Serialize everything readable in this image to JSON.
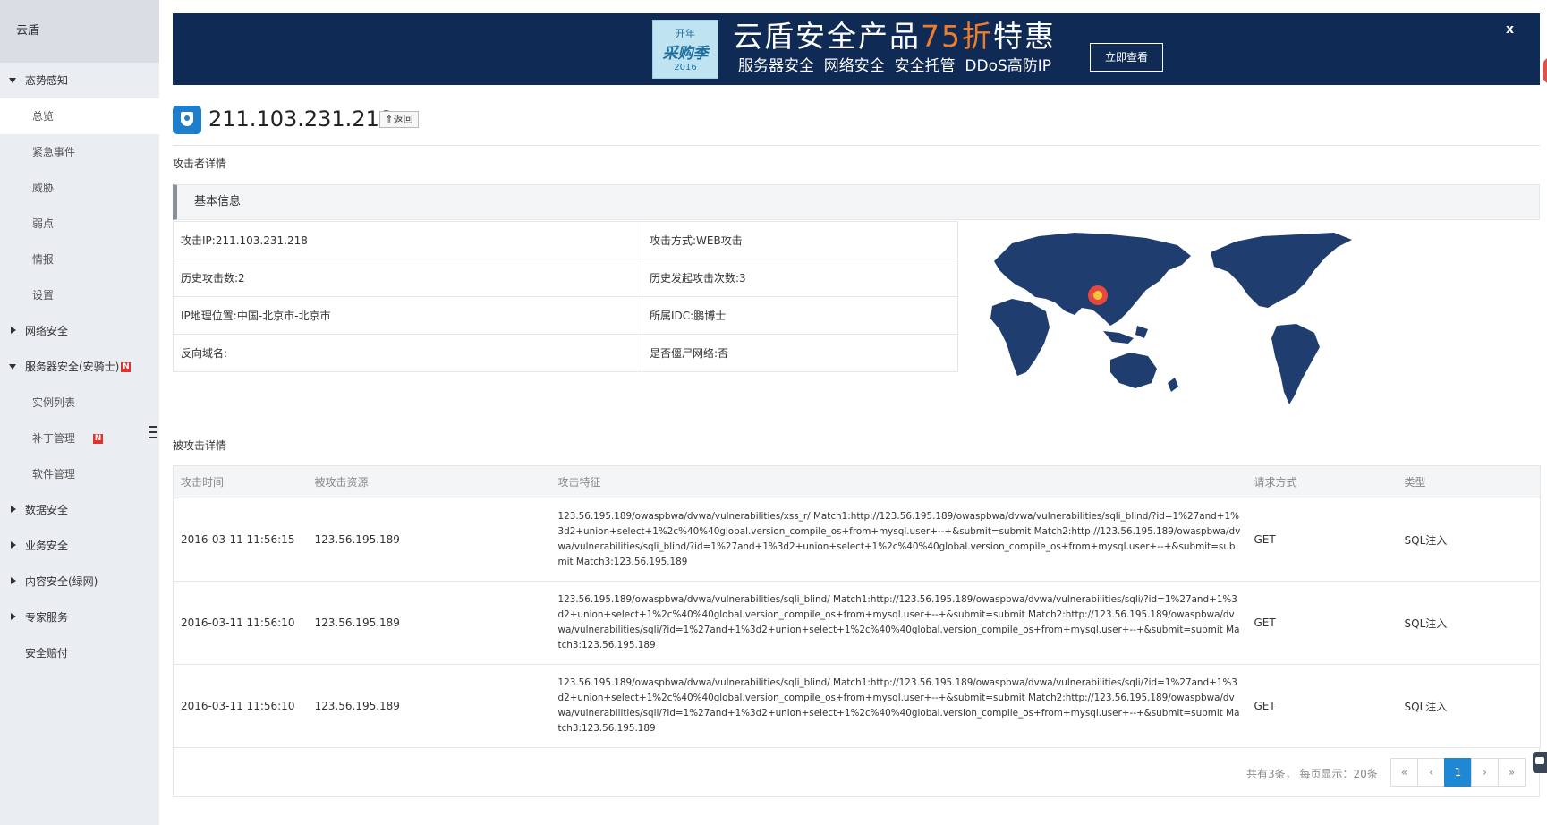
{
  "sidebar": {
    "title": "云盾",
    "items": [
      {
        "label": "态势感知",
        "caret": "down"
      },
      {
        "label": "总览"
      },
      {
        "label": "紧急事件"
      },
      {
        "label": "威胁"
      },
      {
        "label": "弱点"
      },
      {
        "label": "情报"
      },
      {
        "label": "设置"
      },
      {
        "label": "网络安全",
        "caret": "right"
      },
      {
        "label": "服务器安全(安骑士)",
        "caret": "down",
        "badge": "N"
      },
      {
        "label": "实例列表"
      },
      {
        "label": "补丁管理",
        "badge": "N"
      },
      {
        "label": "软件管理"
      },
      {
        "label": "数据安全",
        "caret": "right"
      },
      {
        "label": "业务安全",
        "caret": "right"
      },
      {
        "label": "内容安全(绿网)",
        "caret": "right"
      },
      {
        "label": "专家服务",
        "caret": "right"
      },
      {
        "label": "安全赔付"
      }
    ]
  },
  "banner": {
    "logo_line1": "开年",
    "logo_line2": "采购季",
    "logo_line3": "2016",
    "title_prefix": "云盾安全产品",
    "title_accent": "75折",
    "title_suffix": "特惠",
    "subtitle": "服务器安全  网络安全  安全托管  DDoS高防IP",
    "button_label": "立即查看",
    "close_label": "x"
  },
  "header": {
    "ip": "211.103.231.218",
    "back_label": "⇑返回"
  },
  "attacker_section_label": "攻击者详情",
  "basic_info": {
    "title": "基本信息",
    "rows": [
      [
        "攻击IP:211.103.231.218",
        "攻击方式:WEB攻击"
      ],
      [
        "历史攻击数:2",
        "历史发起攻击次数:3"
      ],
      [
        "IP地理位置:中国-北京市-北京市",
        "所属IDC:鹏博士"
      ],
      [
        "反向域名:",
        "是否僵尸网络:否"
      ]
    ]
  },
  "attacked_section_label": "被攻击详情",
  "attack_table": {
    "columns": [
      "攻击时间",
      "被攻击资源",
      "攻击特征",
      "请求方式",
      "类型"
    ],
    "rows": [
      [
        "2016-03-11 11:56:15",
        "123.56.195.189",
        "123.56.195.189/owaspbwa/dvwa/vulnerabilities/xss_r/ Match1:http://123.56.195.189/owaspbwa/dvwa/vulnerabilities/sqli_blind/?id=1%27and+1%3d2+union+select+1%2c%40%40global.version_compile_os+from+mysql.user+--+&submit=submit Match2:http://123.56.195.189/owaspbwa/dvwa/vulnerabilities/sqli_blind/?id=1%27and+1%3d2+union+select+1%2c%40%40global.version_compile_os+from+mysql.user+--+&submit=submit Match3:123.56.195.189",
        "GET",
        "SQL注入"
      ],
      [
        "2016-03-11 11:56:10",
        "123.56.195.189",
        "123.56.195.189/owaspbwa/dvwa/vulnerabilities/sqli_blind/ Match1:http://123.56.195.189/owaspbwa/dvwa/vulnerabilities/sqli/?id=1%27and+1%3d2+union+select+1%2c%40%40global.version_compile_os+from+mysql.user+--+&submit=submit Match2:http://123.56.195.189/owaspbwa/dvwa/vulnerabilities/sqli/?id=1%27and+1%3d2+union+select+1%2c%40%40global.version_compile_os+from+mysql.user+--+&submit=submit Match3:123.56.195.189",
        "GET",
        "SQL注入"
      ],
      [
        "2016-03-11 11:56:10",
        "123.56.195.189",
        "123.56.195.189/owaspbwa/dvwa/vulnerabilities/sqli_blind/ Match1:http://123.56.195.189/owaspbwa/dvwa/vulnerabilities/sqli/?id=1%27and+1%3d2+union+select+1%2c%40%40global.version_compile_os+from+mysql.user+--+&submit=submit Match2:http://123.56.195.189/owaspbwa/dvwa/vulnerabilities/sqli/?id=1%27and+1%3d2+union+select+1%2c%40%40global.version_compile_os+from+mysql.user+--+&submit=submit Match3:123.56.195.189",
        "GET",
        "SQL注入"
      ]
    ]
  },
  "pagination": {
    "summary": "共有3条， 每页显示：20条",
    "first": "«",
    "prev": "‹",
    "current": "1",
    "next": "›",
    "last": "»"
  },
  "colors": {
    "banner_bg": "#0f2a55",
    "accent_orange": "#ef7c2d",
    "primary_blue": "#1e88d4",
    "map_land": "#1f3d6e",
    "marker": "#e8493f"
  }
}
